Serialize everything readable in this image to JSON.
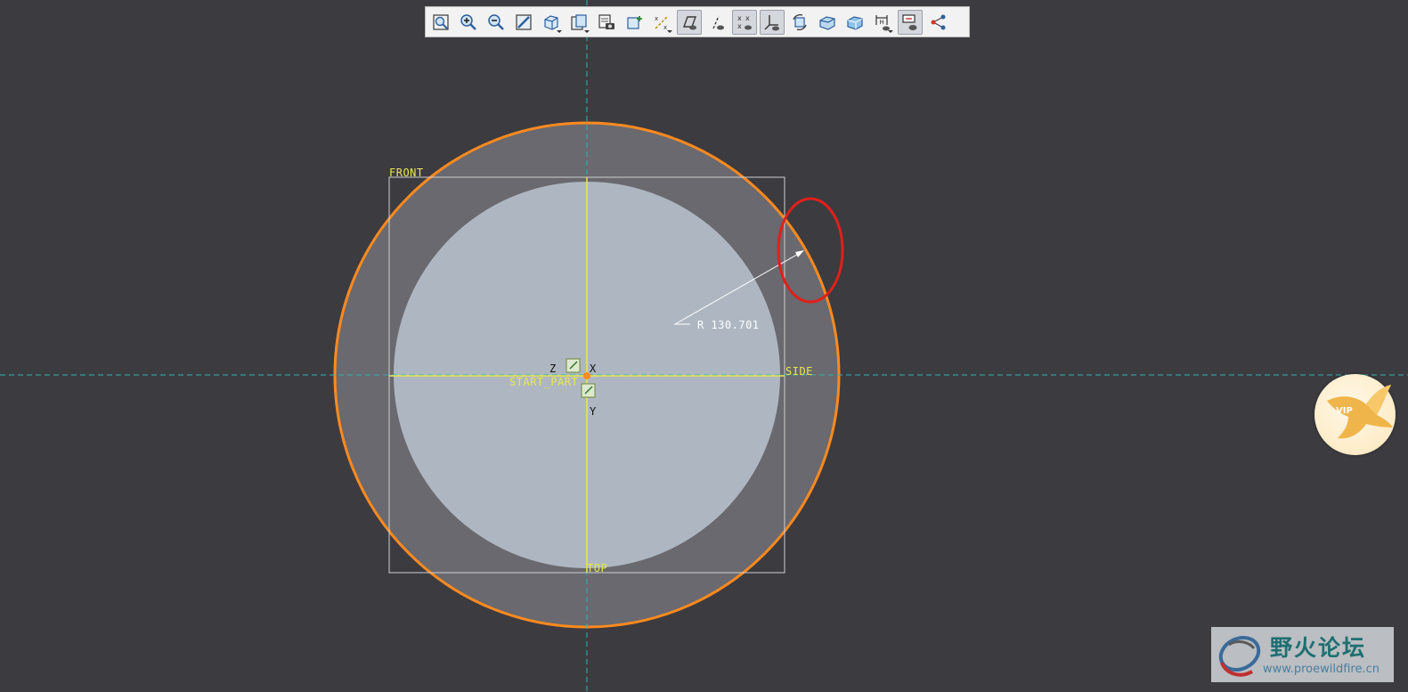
{
  "viewport": {
    "background": "#3c3b40",
    "datum_color": "#e8e84a",
    "sketch_color": "#ff8a1f",
    "highlight_color": "#e0201a",
    "centerline_color": "#2fb3b3"
  },
  "toolbar": {
    "buttons": [
      {
        "name": "refit-icon",
        "label": "Refit"
      },
      {
        "name": "zoom-in-icon",
        "label": "Zoom In"
      },
      {
        "name": "zoom-out-icon",
        "label": "Zoom Out"
      },
      {
        "name": "repaint-icon",
        "label": "Repaint"
      },
      {
        "name": "display-style-icon",
        "label": "Display Style"
      },
      {
        "name": "saved-orientations-icon",
        "label": "Saved Orientations"
      },
      {
        "name": "view-manager-icon",
        "label": "View Manager"
      },
      {
        "name": "sketch-view-icon",
        "label": "Sketch View"
      },
      {
        "name": "datum-display-filters-icon",
        "label": "Datum Display Filters"
      },
      {
        "name": "plane-display-icon",
        "label": "Plane Display"
      },
      {
        "name": "axis-display-icon",
        "label": "Axis Display"
      },
      {
        "name": "point-display-icon",
        "label": "Point Display"
      },
      {
        "name": "csys-display-icon",
        "label": "Csys Display"
      },
      {
        "name": "spin-center-icon",
        "label": "Spin Center"
      },
      {
        "name": "sketch-display-icon",
        "label": "Sketch Display"
      },
      {
        "name": "shaded-icon",
        "label": "Shaded"
      },
      {
        "name": "dimension-display-icon",
        "label": "Dimension Display"
      },
      {
        "name": "constraint-display-icon",
        "label": "Constraint Display"
      },
      {
        "name": "vertex-display-icon",
        "label": "Vertex Display"
      }
    ]
  },
  "datums": {
    "front": "FRONT",
    "side": "SIDE",
    "top": "TOP",
    "csys": "START_PART",
    "axis_x": "X",
    "axis_y": "Y",
    "axis_z": "Z"
  },
  "dimension": {
    "radius_text": "R 130.701"
  },
  "watermark": {
    "title": "野火论坛",
    "url": "www.proewildfire.cn"
  },
  "vip_badge": {
    "text": "VIP"
  }
}
